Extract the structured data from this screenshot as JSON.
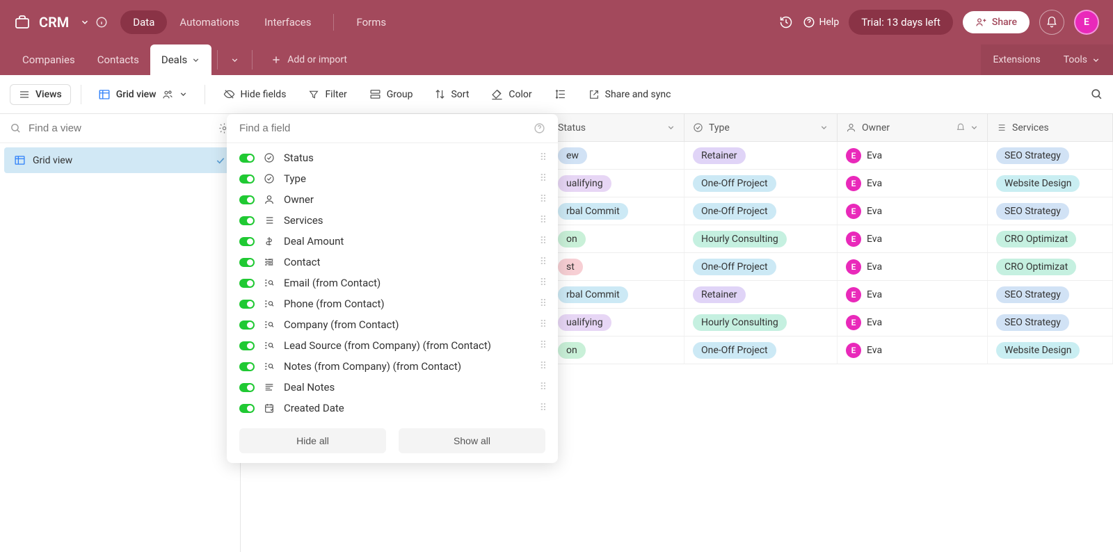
{
  "app": {
    "title": "CRM"
  },
  "top_tabs": [
    "Data",
    "Automations",
    "Interfaces",
    "Forms"
  ],
  "top_active": 0,
  "help": "Help",
  "trial": "Trial: 13 days left",
  "share": "Share",
  "avatar_letter": "E",
  "table_tabs": [
    "Companies",
    "Contacts",
    "Deals"
  ],
  "table_active": 2,
  "add_import": "Add or import",
  "extensions": "Extensions",
  "tools": "Tools",
  "toolbar": {
    "views": "Views",
    "grid_view": "Grid view",
    "hide_fields": "Hide fields",
    "filter": "Filter",
    "group": "Group",
    "sort": "Sort",
    "color": "Color",
    "share_sync": "Share and sync"
  },
  "find_view_placeholder": "Find a view",
  "views_list": [
    {
      "label": "Grid view"
    }
  ],
  "popover": {
    "search_placeholder": "Find a field",
    "fields": [
      {
        "label": "Status",
        "icon": "check-circle"
      },
      {
        "label": "Type",
        "icon": "check-circle"
      },
      {
        "label": "Owner",
        "icon": "user"
      },
      {
        "label": "Services",
        "icon": "list"
      },
      {
        "label": "Deal Amount",
        "icon": "currency"
      },
      {
        "label": "Contact",
        "icon": "link"
      },
      {
        "label": "Email (from Contact)",
        "icon": "lookup"
      },
      {
        "label": "Phone (from Contact)",
        "icon": "lookup"
      },
      {
        "label": "Company (from Contact)",
        "icon": "lookup"
      },
      {
        "label": "Lead Source (from Company) (from Contact)",
        "icon": "lookup"
      },
      {
        "label": "Notes (from Company) (from Contact)",
        "icon": "lookup"
      },
      {
        "label": "Deal Notes",
        "icon": "text"
      },
      {
        "label": "Created Date",
        "icon": "calendar"
      }
    ],
    "hide_all": "Hide all",
    "show_all": "Show all"
  },
  "columns": [
    "Status",
    "Type",
    "Owner",
    "Services"
  ],
  "rows": [
    {
      "status": "ew",
      "status_color": "#d1e2f5",
      "type": "Retainer",
      "type_color": "#e0d4f7",
      "owner": "Eva",
      "service": "SEO Strategy",
      "service_color": "#d1e2f5"
    },
    {
      "status": "ualifying",
      "status_color": "#e7d6f5",
      "type": "One-Off Project",
      "type_color": "#cce9f5",
      "owner": "Eva",
      "service": "Website Design",
      "service_color": "#c9eef2"
    },
    {
      "status": "rbal Commit",
      "status_color": "#cce9f5",
      "type": "One-Off Project",
      "type_color": "#cce9f5",
      "owner": "Eva",
      "service": "SEO Strategy",
      "service_color": "#d1e2f5"
    },
    {
      "status": "on",
      "status_color": "#c9f0d8",
      "type": "Hourly Consulting",
      "type_color": "#c5f0e0",
      "owner": "Eva",
      "service": "CRO Optimizat",
      "service_color": "#c5f0e0"
    },
    {
      "status": "st",
      "status_color": "#f7cfd4",
      "type": "One-Off Project",
      "type_color": "#cce9f5",
      "owner": "Eva",
      "service": "CRO Optimizat",
      "service_color": "#c5f0e0"
    },
    {
      "status": "rbal Commit",
      "status_color": "#cce9f5",
      "type": "Retainer",
      "type_color": "#e0d4f7",
      "owner": "Eva",
      "service": "SEO Strategy",
      "service_color": "#d1e2f5"
    },
    {
      "status": "ualifying",
      "status_color": "#e7d6f5",
      "type": "Hourly Consulting",
      "type_color": "#c5f0e0",
      "owner": "Eva",
      "service": "SEO Strategy",
      "service_color": "#d1e2f5"
    },
    {
      "status": "on",
      "status_color": "#c9f0d8",
      "type": "One-Off Project",
      "type_color": "#cce9f5",
      "owner": "Eva",
      "service": "Website Design",
      "service_color": "#c9eef2"
    }
  ]
}
